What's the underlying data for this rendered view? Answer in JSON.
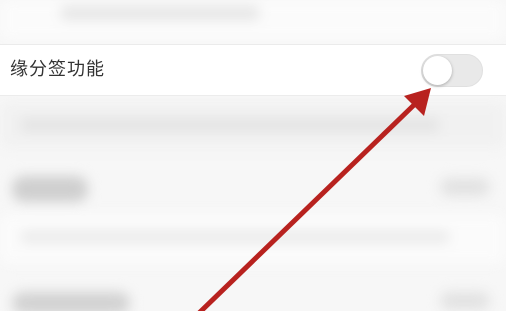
{
  "settings": {
    "row_label": "缘分签功能",
    "toggle_on": false
  },
  "colors": {
    "arrow": "#b8221f",
    "background": "#f7f7f7"
  },
  "icons": {
    "annotation": "red-arrow"
  }
}
